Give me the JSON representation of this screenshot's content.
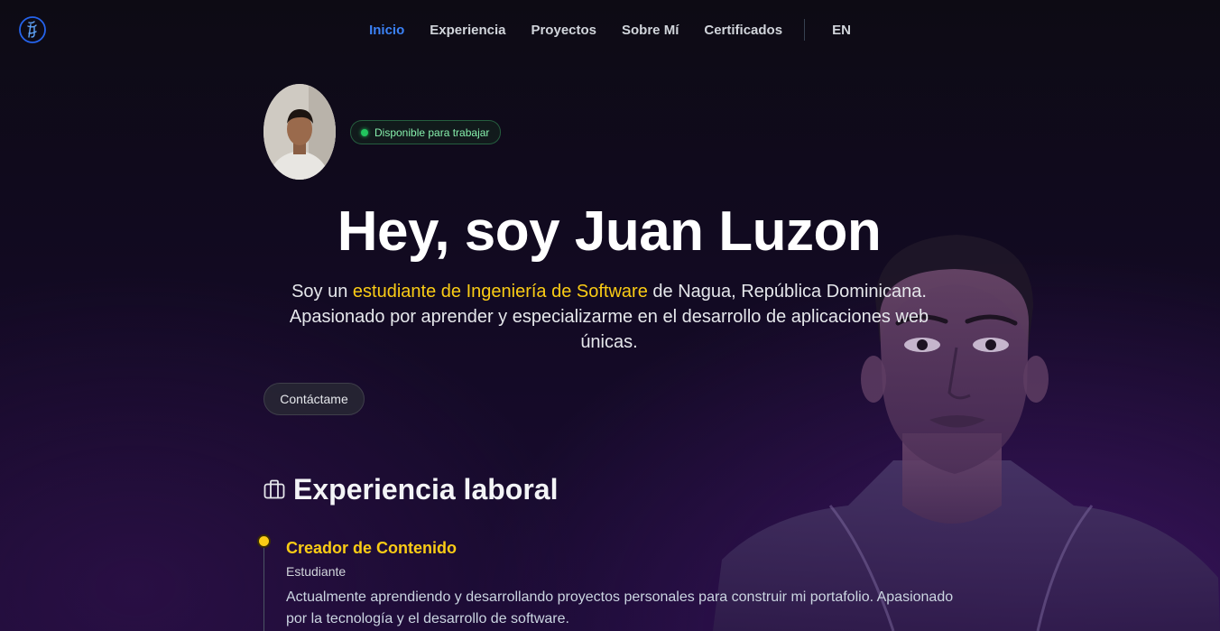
{
  "brand": {
    "logo_icon": "calligraphy-logo-icon",
    "accent": "#3b82f6"
  },
  "nav": {
    "items": [
      {
        "label": "Inicio",
        "active": true
      },
      {
        "label": "Experiencia",
        "active": false
      },
      {
        "label": "Proyectos",
        "active": false
      },
      {
        "label": "Sobre Mí",
        "active": false
      },
      {
        "label": "Certificados",
        "active": false
      }
    ],
    "language": "EN"
  },
  "hero": {
    "status_badge": "Disponible para trabajar",
    "status_color": "#22c55e",
    "headline": "Hey, soy Juan Luzon",
    "intro_prefix": "Soy un ",
    "intro_highlight": "estudiante de Ingeniería de Software",
    "intro_suffix": " de Nagua, República Dominicana. Apasionado por aprender y especializarme en el desarrollo de aplicaciones web únicas.",
    "highlight_color": "#facc15",
    "contact_button": "Contáctame"
  },
  "experience": {
    "title": "Experiencia laboral",
    "icon": "briefcase-icon",
    "jobs": [
      {
        "title": "Creador de Contenido",
        "role": "Estudiante",
        "description": "Actualmente aprendiendo y desarrollando proyectos personales para construir mi portafolio. Apasionado por la tecnología y el desarrollo de software."
      }
    ]
  }
}
